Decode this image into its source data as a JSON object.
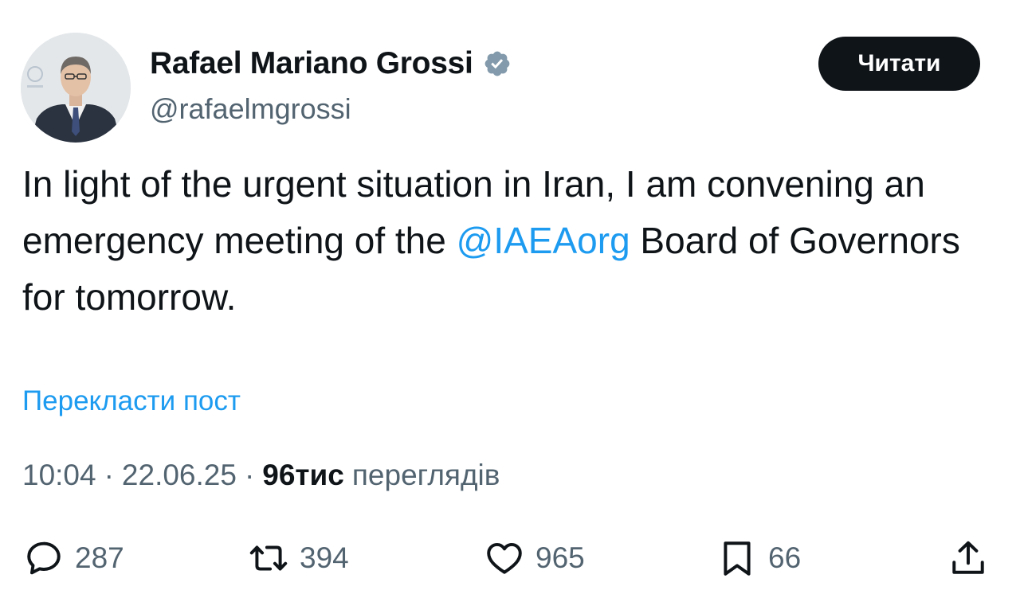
{
  "author": {
    "display_name": "Rafael Mariano Grossi",
    "handle": "@rafaelmgrossi",
    "verified_icon": "verified-badge-icon"
  },
  "follow_button": {
    "label": "Читати"
  },
  "post": {
    "text_before_mention": "In light of the urgent situation in Iran, I am convening an emergency meeting of the ",
    "mention": "@IAEAorg",
    "text_after_mention": " Board of Governors for tomorrow.",
    "translate_label": "Перекласти пост"
  },
  "meta": {
    "time": "10:04",
    "date": "22.06.25",
    "separator": "·",
    "views_count": "96тис",
    "views_label": "переглядів"
  },
  "actions": {
    "reply": {
      "icon": "reply-icon",
      "count": "287"
    },
    "repost": {
      "icon": "repost-icon",
      "count": "394"
    },
    "like": {
      "icon": "heart-icon",
      "count": "965"
    },
    "bookmark": {
      "icon": "bookmark-icon",
      "count": "66"
    },
    "share": {
      "icon": "share-icon"
    }
  },
  "colors": {
    "text": "#0f1419",
    "secondary": "#536471",
    "link": "#1d9bf0",
    "button_bg": "#0f1419"
  }
}
